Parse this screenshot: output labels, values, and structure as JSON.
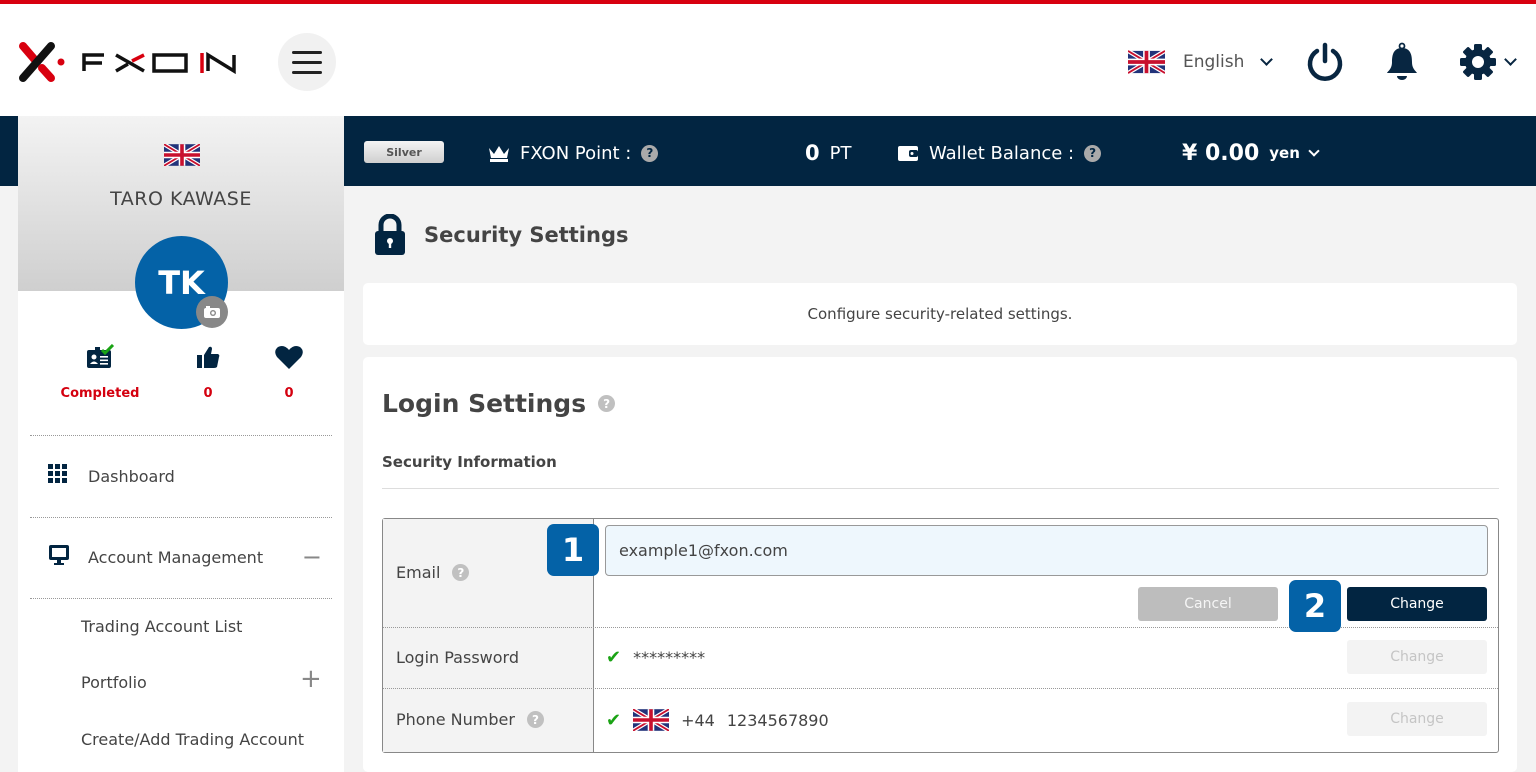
{
  "header": {
    "brand": "FXON",
    "language": "English",
    "colors": {
      "accent_red": "#d8000f",
      "navy": "#022541",
      "badge_blue": "#0462a7"
    }
  },
  "band": {
    "rank": "Silver",
    "point_label": "FXON Point :",
    "point_value": "0",
    "point_unit": "PT",
    "wallet_label": "Wallet Balance :",
    "wallet_value": "¥ 0.00",
    "wallet_currency": "yen"
  },
  "sidebar": {
    "user_name": "TARO KAWASE",
    "avatar_initials": "TK",
    "stats": [
      {
        "icon": "id-card-check-icon",
        "value": "Completed"
      },
      {
        "icon": "thumbs-up-icon",
        "value": "0"
      },
      {
        "icon": "heart-icon",
        "value": "0"
      }
    ],
    "nav": [
      {
        "label": "Dashboard",
        "icon": "grid-icon"
      },
      {
        "label": "Account Management",
        "icon": "monitor-icon",
        "toggle": "−"
      }
    ],
    "sub_items": [
      {
        "label": "Trading Account List"
      },
      {
        "label": "Portfolio",
        "toggle": "+"
      },
      {
        "label": "Create/Add Trading Account"
      }
    ]
  },
  "main": {
    "page_title": "Security Settings",
    "description": "Configure security-related settings.",
    "section_title": "Login Settings",
    "subsection_title": "Security Information",
    "rows": [
      {
        "label": "Email",
        "value": "example1@fxon.com"
      },
      {
        "label": "Login Password",
        "value": "*********"
      },
      {
        "label": "Phone Number",
        "country_code": "+44",
        "value": "1234567890"
      }
    ],
    "buttons": {
      "cancel": "Cancel",
      "change": "Change"
    },
    "step_badges": [
      "1",
      "2"
    ]
  }
}
